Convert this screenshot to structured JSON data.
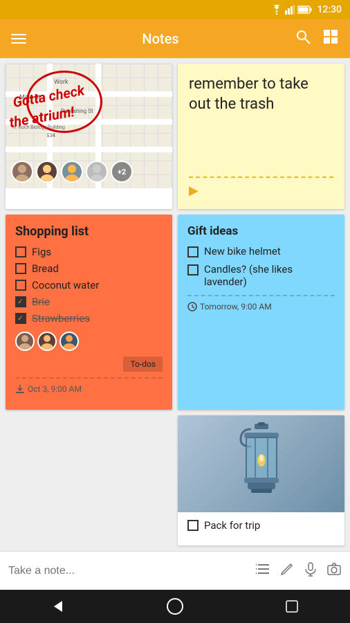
{
  "statusBar": {
    "time": "12:30",
    "wifiIcon": "wifi",
    "signalIcon": "signal",
    "batteryIcon": "battery"
  },
  "toolbar": {
    "title": "Notes",
    "menuIcon": "menu",
    "searchIcon": "search",
    "gridIcon": "grid"
  },
  "notes": {
    "mapNote": {
      "overlayLine1": "Gotta check",
      "overlayLine2": "the atrium!",
      "avatarCount": "+2",
      "mapLabels": [
        "Work",
        "Main St"
      ]
    },
    "yellowNote": {
      "text": "remember to take out the trash",
      "playIcon": "play"
    },
    "shoppingList": {
      "title": "Shopping list",
      "items": [
        {
          "label": "Figs",
          "checked": false,
          "strikethrough": false
        },
        {
          "label": "Bread",
          "checked": false,
          "strikethrough": false
        },
        {
          "label": "Coconut water",
          "checked": false,
          "strikethrough": false
        },
        {
          "label": "Brie",
          "checked": true,
          "strikethrough": true
        },
        {
          "label": "Strawberries",
          "checked": true,
          "strikethrough": true
        }
      ],
      "badgeLabel": "To-dos",
      "dateIcon": "download",
      "date": "Oct 3, 9:00 AM"
    },
    "giftIdeas": {
      "title": "Gift ideas",
      "items": [
        {
          "label": "New bike helmet",
          "checked": false
        },
        {
          "label": "Candles? (she likes lavender)",
          "checked": false
        }
      ],
      "timeIcon": "clock",
      "time": "Tomorrow, 9:00 AM"
    },
    "lanternNote": {
      "item": "Pack for trip",
      "checked": false
    }
  },
  "inputBar": {
    "placeholder": "Take a note...",
    "listIcon": "list",
    "pencilIcon": "pencil",
    "micIcon": "microphone",
    "cameraIcon": "camera"
  },
  "navBar": {
    "backIcon": "back-triangle",
    "homeIcon": "home-circle",
    "recentIcon": "recent-square"
  }
}
